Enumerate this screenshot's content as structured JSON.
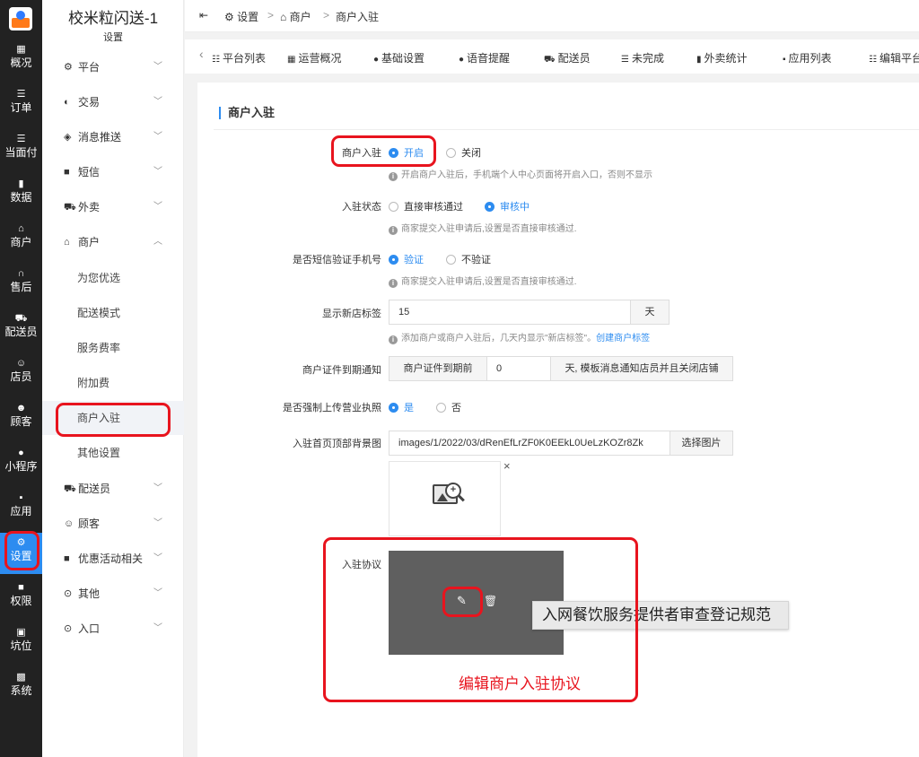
{
  "app": {
    "title": "校米粒闪送-1",
    "subtitle": "设置"
  },
  "rail": [
    {
      "icon": "grid-icon",
      "glyph": "▦",
      "label": "概况"
    },
    {
      "icon": "list-icon",
      "glyph": "☰",
      "label": "订单"
    },
    {
      "icon": "list-icon",
      "glyph": "☰",
      "label": "当面付"
    },
    {
      "icon": "chart-icon",
      "glyph": "▮",
      "label": "数据"
    },
    {
      "icon": "store-icon",
      "glyph": "⌂",
      "label": "商户"
    },
    {
      "icon": "headset-icon",
      "glyph": "∩",
      "label": "售后"
    },
    {
      "icon": "scooter-icon",
      "glyph": "⛟",
      "label": "配送员"
    },
    {
      "icon": "user-icon",
      "glyph": "☺",
      "label": "店员"
    },
    {
      "icon": "customer-icon",
      "glyph": "☻",
      "label": "顾客"
    },
    {
      "icon": "wechat-icon",
      "glyph": "●",
      "label": "小程序"
    },
    {
      "icon": "apps-icon",
      "glyph": "▪",
      "label": "应用"
    },
    {
      "icon": "settings-icon",
      "glyph": "⚙",
      "label": "设置"
    },
    {
      "icon": "lock-icon",
      "glyph": "■",
      "label": "权限"
    },
    {
      "icon": "slot-icon",
      "glyph": "▣",
      "label": "坑位"
    },
    {
      "icon": "system-icon",
      "glyph": "▩",
      "label": "系统"
    }
  ],
  "menu": [
    {
      "icon": "gear-icon",
      "glyph": "⚙",
      "label": "平台",
      "chev": "﹀"
    },
    {
      "icon": "trade-icon",
      "glyph": "◐",
      "label": "交易",
      "chev": "﹀"
    },
    {
      "icon": "message-icon",
      "glyph": "◈",
      "label": "消息推送",
      "chev": "﹀"
    },
    {
      "icon": "sms-icon",
      "glyph": "■",
      "label": "短信",
      "chev": "﹀"
    },
    {
      "icon": "scooter-icon",
      "glyph": "⛟",
      "label": "外卖",
      "chev": "﹀"
    },
    {
      "icon": "store-icon",
      "glyph": "⌂",
      "label": "商户",
      "chev": "︿"
    }
  ],
  "submenu": [
    "为您优选",
    "配送模式",
    "服务费率",
    "附加费",
    "商户入驻",
    "其他设置"
  ],
  "menu2": [
    {
      "icon": "scooter-icon",
      "glyph": "⛟",
      "label": "配送员",
      "chev": "﹀"
    },
    {
      "icon": "customer-icon",
      "glyph": "☺",
      "label": "顾客",
      "chev": "﹀"
    },
    {
      "icon": "gift-icon",
      "glyph": "■",
      "label": "优惠活动相关",
      "chev": "﹀"
    },
    {
      "icon": "other-icon",
      "glyph": "⊙",
      "label": "其他",
      "chev": "﹀"
    },
    {
      "icon": "entry-icon",
      "glyph": "⊙",
      "label": "入口",
      "chev": "﹀"
    }
  ],
  "breadcrumb": {
    "toggle": "⇤",
    "settings": "设置",
    "sep1": ">",
    "merchant": "商户",
    "sep2": ">",
    "current": "商户入驻"
  },
  "tabs": {
    "prev": "‹",
    "items": [
      {
        "icon": "list-icon",
        "glyph": "☷",
        "label": "平台列表"
      },
      {
        "icon": "grid-icon",
        "glyph": "▦",
        "label": "运营概况"
      },
      {
        "icon": "chat-icon",
        "glyph": "●",
        "label": "基础设置"
      },
      {
        "icon": "chat-icon",
        "glyph": "●",
        "label": "语音提醒"
      },
      {
        "icon": "scooter-icon",
        "glyph": "⛟",
        "label": "配送员"
      },
      {
        "icon": "list-icon",
        "glyph": "☰",
        "label": "未完成"
      },
      {
        "icon": "chart-icon",
        "glyph": "▮",
        "label": "外卖统计"
      },
      {
        "icon": "apps-icon",
        "glyph": "▪",
        "label": "应用列表"
      },
      {
        "icon": "list-icon",
        "glyph": "☷",
        "label": "编辑平台"
      }
    ]
  },
  "section": {
    "title": "商户入驻"
  },
  "form": {
    "entry": {
      "label": "商户入驻",
      "on": "开启",
      "off": "关闭",
      "hint": "开启商户入驻后，手机端个人中心页面将开启入口，否则不显示"
    },
    "status": {
      "label": "入驻状态",
      "opt1": "直接审核通过",
      "opt2": "审核中",
      "hint": "商家提交入驻申请后,设置是否直接审核通过."
    },
    "sms": {
      "label": "是否短信验证手机号",
      "opt1": "验证",
      "opt2": "不验证",
      "hint": "商家提交入驻申请后,设置是否直接审核通过."
    },
    "newtag": {
      "label": "显示新店标签",
      "value": "15",
      "unit": "天",
      "hint": "添加商户或商户入驻后，几天内显示\"新店标签\"。",
      "link": "创建商户标签"
    },
    "cert": {
      "label": "商户证件到期通知",
      "prefix": "商户证件到期前",
      "value": "0",
      "suffix": "天, 模板消息通知店员并且关闭店铺"
    },
    "license": {
      "label": "是否强制上传营业执照",
      "yes": "是",
      "no": "否"
    },
    "bg": {
      "label": "入驻首页顶部背景图",
      "value": "images/1/2022/03/dRenEfLrZF0K0EEkL0UeLzKOZr8Zk",
      "button": "选择图片",
      "close": "×"
    },
    "agreement": {
      "label": "入驻协议",
      "edit": "✎",
      "delete": "🗑",
      "tooltip": "入网餐饮服务提供者审查登记规范"
    }
  },
  "annotation": {
    "text": "编辑商户入驻协议",
    "color": "#e8141e"
  },
  "colors": {
    "accent": "#2d8cf0",
    "rail": "#222222"
  },
  "info_glyph": "i"
}
